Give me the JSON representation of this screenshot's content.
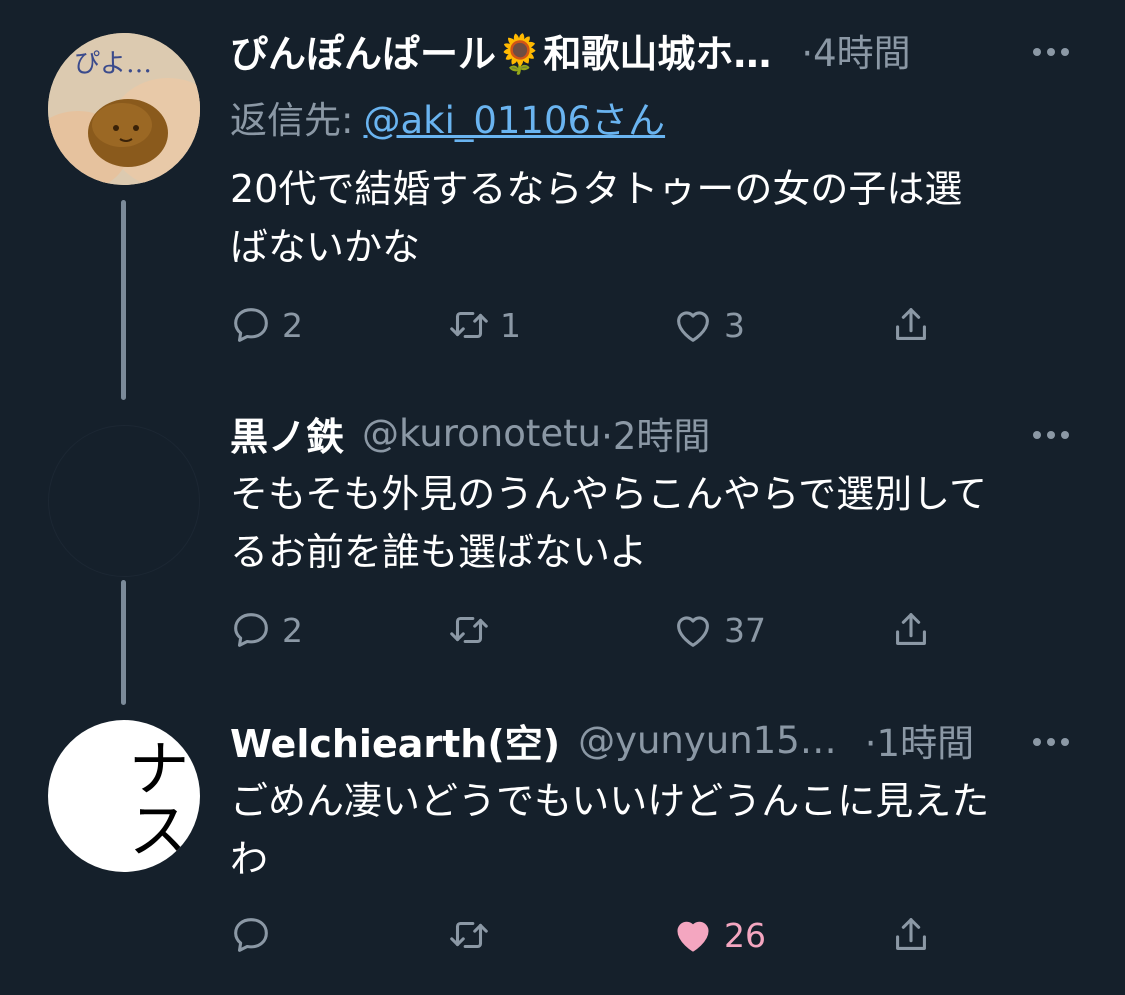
{
  "tweets": [
    {
      "display_name": "ぴんぽんぱール🌻和歌山城ホ…",
      "time": "·4時間",
      "reply_prefix": "返信先:",
      "reply_handle": "@aki_01106さん",
      "text_lines": [
        "20代で結婚するならタトゥーの女の子は選",
        "ばないかな"
      ],
      "avatar_caption": "ぴよ…",
      "replies": "2",
      "retweets": "1",
      "likes": "3"
    },
    {
      "display_name": "黒ノ鉄",
      "handle": "@kuronotetu",
      "time": "·2時間",
      "text_lines": [
        "そもそも外見のうんやらこんやらで選別して",
        "るお前を誰も選ばないよ"
      ],
      "replies": "2",
      "retweets": "",
      "likes": "37"
    },
    {
      "display_name": "Welchiearth(空)",
      "handle": "@yunyun15…",
      "time": "·1時間",
      "text_lines": [
        "ごめん凄いどうでもいいけどうんこに見えた",
        "わ"
      ],
      "avatar_text": "ナス",
      "replies": "",
      "retweets": "",
      "likes": "26"
    }
  ],
  "icons": {
    "reply": "reply-icon",
    "retweet": "retweet-icon",
    "like": "heart-icon",
    "liked": "heart-filled-icon",
    "share": "share-icon",
    "more": "more-icon"
  },
  "colors": {
    "background": "#15202b",
    "text": "#ffffff",
    "muted": "#8b98a5",
    "link": "#6ab4f0",
    "like": "#f4a6c0",
    "thread_line": "#7b8a99"
  }
}
